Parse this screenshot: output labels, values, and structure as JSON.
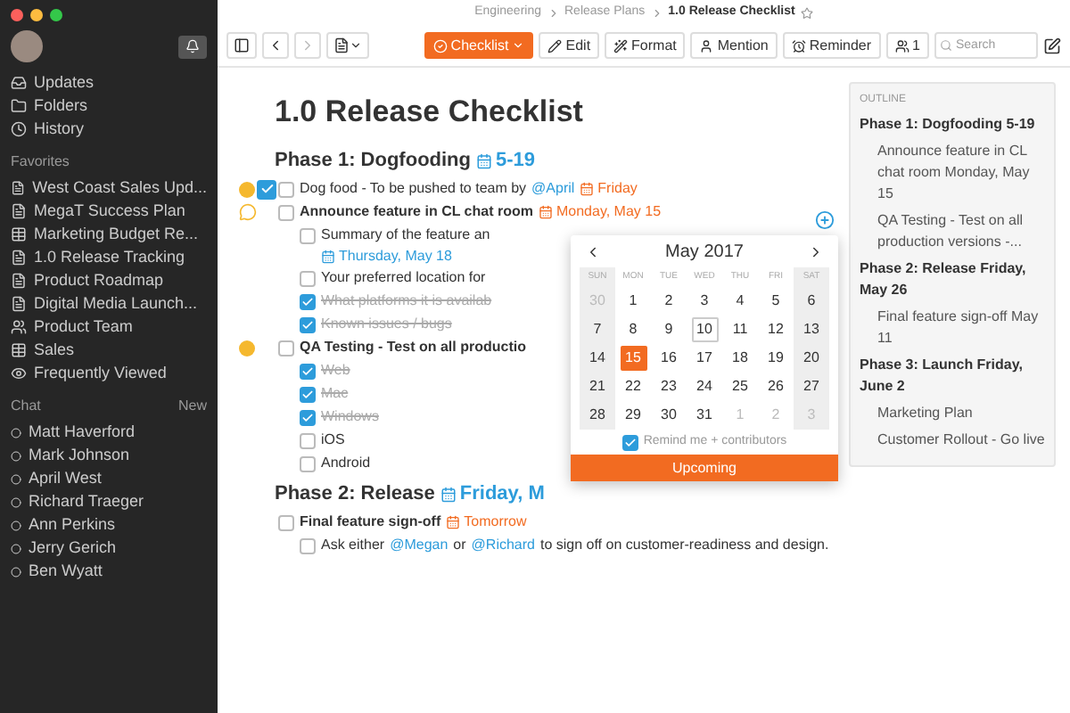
{
  "sidebar": {
    "nav": [
      {
        "kind": "updates",
        "label": "Updates"
      },
      {
        "kind": "folders",
        "label": "Folders"
      },
      {
        "kind": "history",
        "label": "History"
      }
    ],
    "favorites_title": "Favorites",
    "favorites": [
      {
        "kind": "doc",
        "label": "West Coast Sales Upd..."
      },
      {
        "kind": "doc",
        "label": "MegaT Success Plan"
      },
      {
        "kind": "sheet",
        "label": "Marketing Budget Re..."
      },
      {
        "kind": "doc",
        "label": "1.0 Release Tracking"
      },
      {
        "kind": "doc",
        "label": "Product Roadmap"
      },
      {
        "kind": "doc",
        "label": "Digital Media Launch..."
      },
      {
        "kind": "team",
        "label": "Product Team"
      },
      {
        "kind": "sheet",
        "label": "Sales"
      },
      {
        "kind": "viewed",
        "label": "Frequently Viewed"
      }
    ],
    "chat_title": "Chat",
    "chat_action": "New",
    "chats": [
      "Matt Haverford",
      "Mark Johnson",
      "April West",
      "Richard Traeger",
      "Ann Perkins",
      "Jerry Gerich",
      "Ben Wyatt"
    ]
  },
  "breadcrumb": [
    "Engineering",
    "Release Plans",
    "1.0 Release Checklist"
  ],
  "toolbar": {
    "checklist": "Checklist",
    "buttons": [
      {
        "kind": "edit",
        "label": "Edit"
      },
      {
        "kind": "format",
        "label": "Format"
      },
      {
        "kind": "mention",
        "label": "Mention"
      },
      {
        "kind": "reminder",
        "label": "Reminder"
      }
    ],
    "members": "1",
    "search": {
      "placeholder": "Search"
    }
  },
  "document": {
    "title": "1.0 Release Checklist",
    "sections": [
      {
        "heading": "Phase 1: Dogfooding",
        "date": "5-19",
        "items": [
          {
            "badge": true,
            "focused": true,
            "comment": false,
            "checked": false,
            "bold": false,
            "parts": [
              {
                "kind": "text",
                "text": "Dog food - To be pushed to team by"
              },
              {
                "kind": "mention",
                "text": "@April"
              },
              {
                "kind": "due",
                "text": "Friday"
              }
            ]
          },
          {
            "badge": false,
            "focused": false,
            "comment": true,
            "checked": false,
            "bold": true,
            "parts": [
              {
                "kind": "text",
                "text": "Announce feature in CL chat room"
              },
              {
                "kind": "due",
                "text": "Monday, May 15"
              }
            ],
            "children": [
              {
                "checked": false,
                "parts": [
                  {
                    "kind": "text",
                    "text": "Summary of the feature an"
                  }
                ],
                "sub": {
                  "kind": "date",
                  "text": "Thursday, May 18"
                }
              },
              {
                "checked": false,
                "parts": [
                  {
                    "kind": "text",
                    "text": "Your preferred location for"
                  }
                ]
              },
              {
                "checked": true,
                "parts": [
                  {
                    "kind": "text",
                    "text": "What platforms it is availab"
                  }
                ]
              },
              {
                "checked": true,
                "parts": [
                  {
                    "kind": "text",
                    "text": "Known issues / bugs"
                  }
                ]
              }
            ]
          },
          {
            "badge": true,
            "focused": false,
            "comment": false,
            "checked": false,
            "bold": true,
            "parts": [
              {
                "kind": "text",
                "text": "QA Testing - Test on all productio"
              }
            ],
            "children": [
              {
                "checked": true,
                "parts": [
                  {
                    "kind": "text",
                    "text": "Web"
                  }
                ]
              },
              {
                "checked": true,
                "parts": [
                  {
                    "kind": "text",
                    "text": "Mac"
                  }
                ]
              },
              {
                "checked": true,
                "parts": [
                  {
                    "kind": "text",
                    "text": "Windows"
                  }
                ]
              },
              {
                "checked": false,
                "parts": [
                  {
                    "kind": "text",
                    "text": "iOS"
                  }
                ]
              },
              {
                "checked": false,
                "parts": [
                  {
                    "kind": "text",
                    "text": "Android"
                  }
                ]
              }
            ]
          }
        ]
      },
      {
        "heading": "Phase 2: Release",
        "date": "Friday, M",
        "items": [
          {
            "badge": false,
            "focused": false,
            "comment": false,
            "checked": false,
            "bold": true,
            "parts": [
              {
                "kind": "text",
                "text": "Final feature sign-off"
              },
              {
                "kind": "due",
                "text": "Tomorrow"
              }
            ],
            "children": [
              {
                "checked": false,
                "parts": [
                  {
                    "kind": "text",
                    "text": "Ask either"
                  },
                  {
                    "kind": "mention",
                    "text": "@Megan"
                  },
                  {
                    "kind": "text",
                    "text": "or"
                  },
                  {
                    "kind": "mention",
                    "text": "@Richard"
                  },
                  {
                    "kind": "text",
                    "text": "to sign off on customer-readiness and design."
                  }
                ]
              }
            ]
          }
        ]
      }
    ]
  },
  "calendar": {
    "month": "May 2017",
    "weekdays": [
      "SUN",
      "MON",
      "TUE",
      "WED",
      "THU",
      "FRI",
      "SAT"
    ],
    "days": [
      {
        "d": "30",
        "in_month": false,
        "selected": false,
        "today": false
      },
      {
        "d": "1",
        "in_month": true,
        "selected": false,
        "today": false
      },
      {
        "d": "2",
        "in_month": true,
        "selected": false,
        "today": false
      },
      {
        "d": "3",
        "in_month": true,
        "selected": false,
        "today": false
      },
      {
        "d": "4",
        "in_month": true,
        "selected": false,
        "today": false
      },
      {
        "d": "5",
        "in_month": true,
        "selected": false,
        "today": false
      },
      {
        "d": "6",
        "in_month": true,
        "selected": false,
        "today": false
      },
      {
        "d": "7",
        "in_month": true,
        "selected": false,
        "today": false
      },
      {
        "d": "8",
        "in_month": true,
        "selected": false,
        "today": false
      },
      {
        "d": "9",
        "in_month": true,
        "selected": false,
        "today": false
      },
      {
        "d": "10",
        "in_month": true,
        "selected": false,
        "today": true
      },
      {
        "d": "11",
        "in_month": true,
        "selected": false,
        "today": false
      },
      {
        "d": "12",
        "in_month": true,
        "selected": false,
        "today": false
      },
      {
        "d": "13",
        "in_month": true,
        "selected": false,
        "today": false
      },
      {
        "d": "14",
        "in_month": true,
        "selected": false,
        "today": false
      },
      {
        "d": "15",
        "in_month": true,
        "selected": true,
        "today": false
      },
      {
        "d": "16",
        "in_month": true,
        "selected": false,
        "today": false
      },
      {
        "d": "17",
        "in_month": true,
        "selected": false,
        "today": false
      },
      {
        "d": "18",
        "in_month": true,
        "selected": false,
        "today": false
      },
      {
        "d": "19",
        "in_month": true,
        "selected": false,
        "today": false
      },
      {
        "d": "20",
        "in_month": true,
        "selected": false,
        "today": false
      },
      {
        "d": "21",
        "in_month": true,
        "selected": false,
        "today": false
      },
      {
        "d": "22",
        "in_month": true,
        "selected": false,
        "today": false
      },
      {
        "d": "23",
        "in_month": true,
        "selected": false,
        "today": false
      },
      {
        "d": "24",
        "in_month": true,
        "selected": false,
        "today": false
      },
      {
        "d": "25",
        "in_month": true,
        "selected": false,
        "today": false
      },
      {
        "d": "26",
        "in_month": true,
        "selected": false,
        "today": false
      },
      {
        "d": "27",
        "in_month": true,
        "selected": false,
        "today": false
      },
      {
        "d": "28",
        "in_month": true,
        "selected": false,
        "today": false
      },
      {
        "d": "29",
        "in_month": true,
        "selected": false,
        "today": false
      },
      {
        "d": "30",
        "in_month": true,
        "selected": false,
        "today": false
      },
      {
        "d": "31",
        "in_month": true,
        "selected": false,
        "today": false
      },
      {
        "d": "1",
        "in_month": false,
        "selected": false,
        "today": false
      },
      {
        "d": "2",
        "in_month": false,
        "selected": false,
        "today": false
      },
      {
        "d": "3",
        "in_month": false,
        "selected": false,
        "today": false
      }
    ],
    "remind": {
      "label": "Remind me + contributors",
      "checked": true
    },
    "action": "Upcoming"
  },
  "outline": {
    "title": "OUTLINE",
    "items": [
      {
        "kind": "heading",
        "text": "Phase 1: Dogfooding 5-19"
      },
      {
        "kind": "item",
        "text": "Announce feature in CL chat room Monday, May 15"
      },
      {
        "kind": "item",
        "text": "QA Testing - Test on all production versions -..."
      },
      {
        "kind": "heading",
        "text": "Phase 2: Release Friday, May 26"
      },
      {
        "kind": "item",
        "text": "Final feature sign-off May 11"
      },
      {
        "kind": "heading",
        "text": "Phase 3: Launch Friday, June 2"
      },
      {
        "kind": "item",
        "text": "Marketing Plan"
      },
      {
        "kind": "item",
        "text": "Customer Rollout - Go live"
      }
    ]
  }
}
